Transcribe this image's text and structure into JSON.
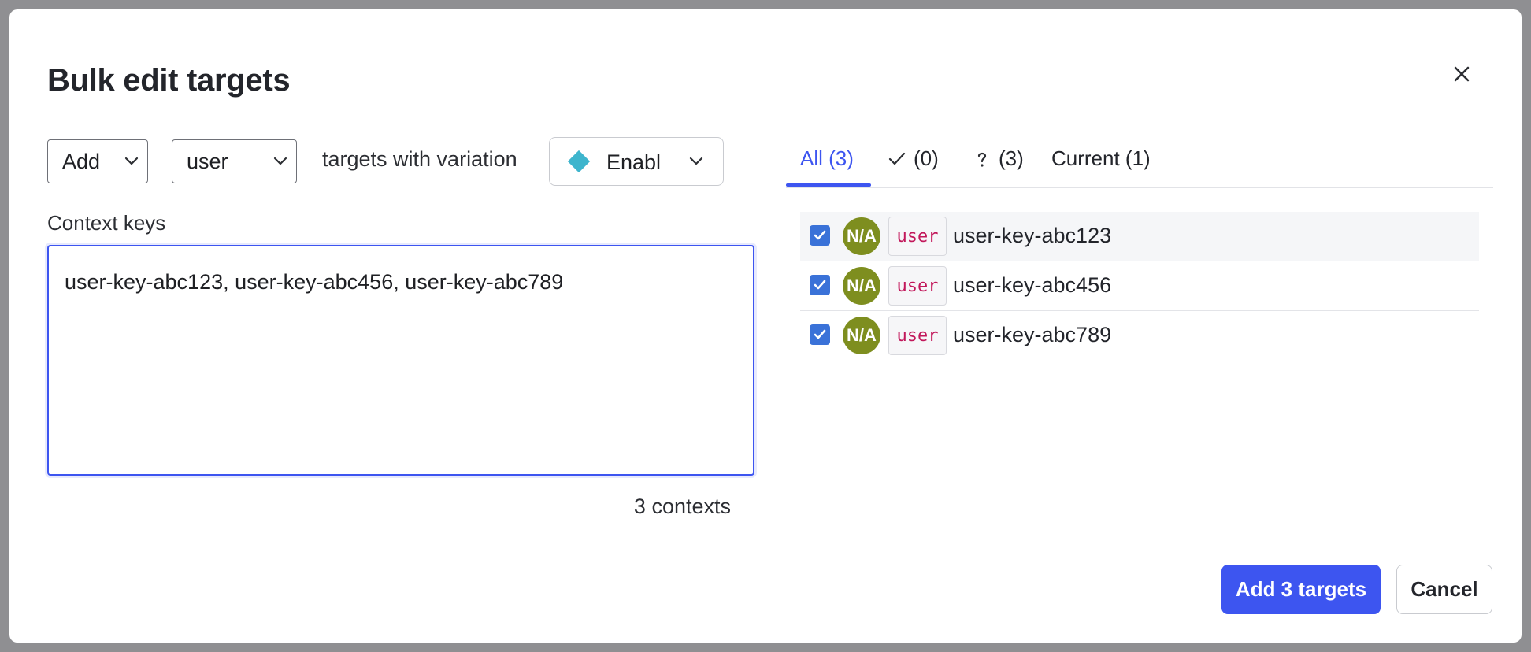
{
  "dialog": {
    "title": "Bulk edit targets",
    "close_icon": "close-icon"
  },
  "controls": {
    "action_value": "Add",
    "context_kind_value": "user",
    "targets_text": "targets with variation",
    "variation": {
      "label": "Enabl",
      "color": "#3eb5cd",
      "icon": "diamond-icon"
    }
  },
  "context_keys": {
    "label": "Context keys",
    "value": "user-key-abc123, user-key-abc456, user-key-abc789",
    "count_text": "3 contexts"
  },
  "tabs": [
    {
      "label": "All (3)",
      "active": true
    },
    {
      "icon": "check-icon",
      "label": "(0)",
      "active": false
    },
    {
      "icon": "question-icon",
      "label": "(3)",
      "active": false
    },
    {
      "label": "Current (1)",
      "active": false
    }
  ],
  "targets": [
    {
      "checked": true,
      "avatar": "N/A",
      "kind": "user",
      "key": "user-key-abc123"
    },
    {
      "checked": true,
      "avatar": "N/A",
      "kind": "user",
      "key": "user-key-abc456"
    },
    {
      "checked": true,
      "avatar": "N/A",
      "kind": "user",
      "key": "user-key-abc789"
    }
  ],
  "footer": {
    "primary_label": "Add 3 targets",
    "cancel_label": "Cancel"
  },
  "colors": {
    "accent": "#3d55f0",
    "avatar": "#7e8e1f",
    "kind_text": "#c2185b"
  }
}
